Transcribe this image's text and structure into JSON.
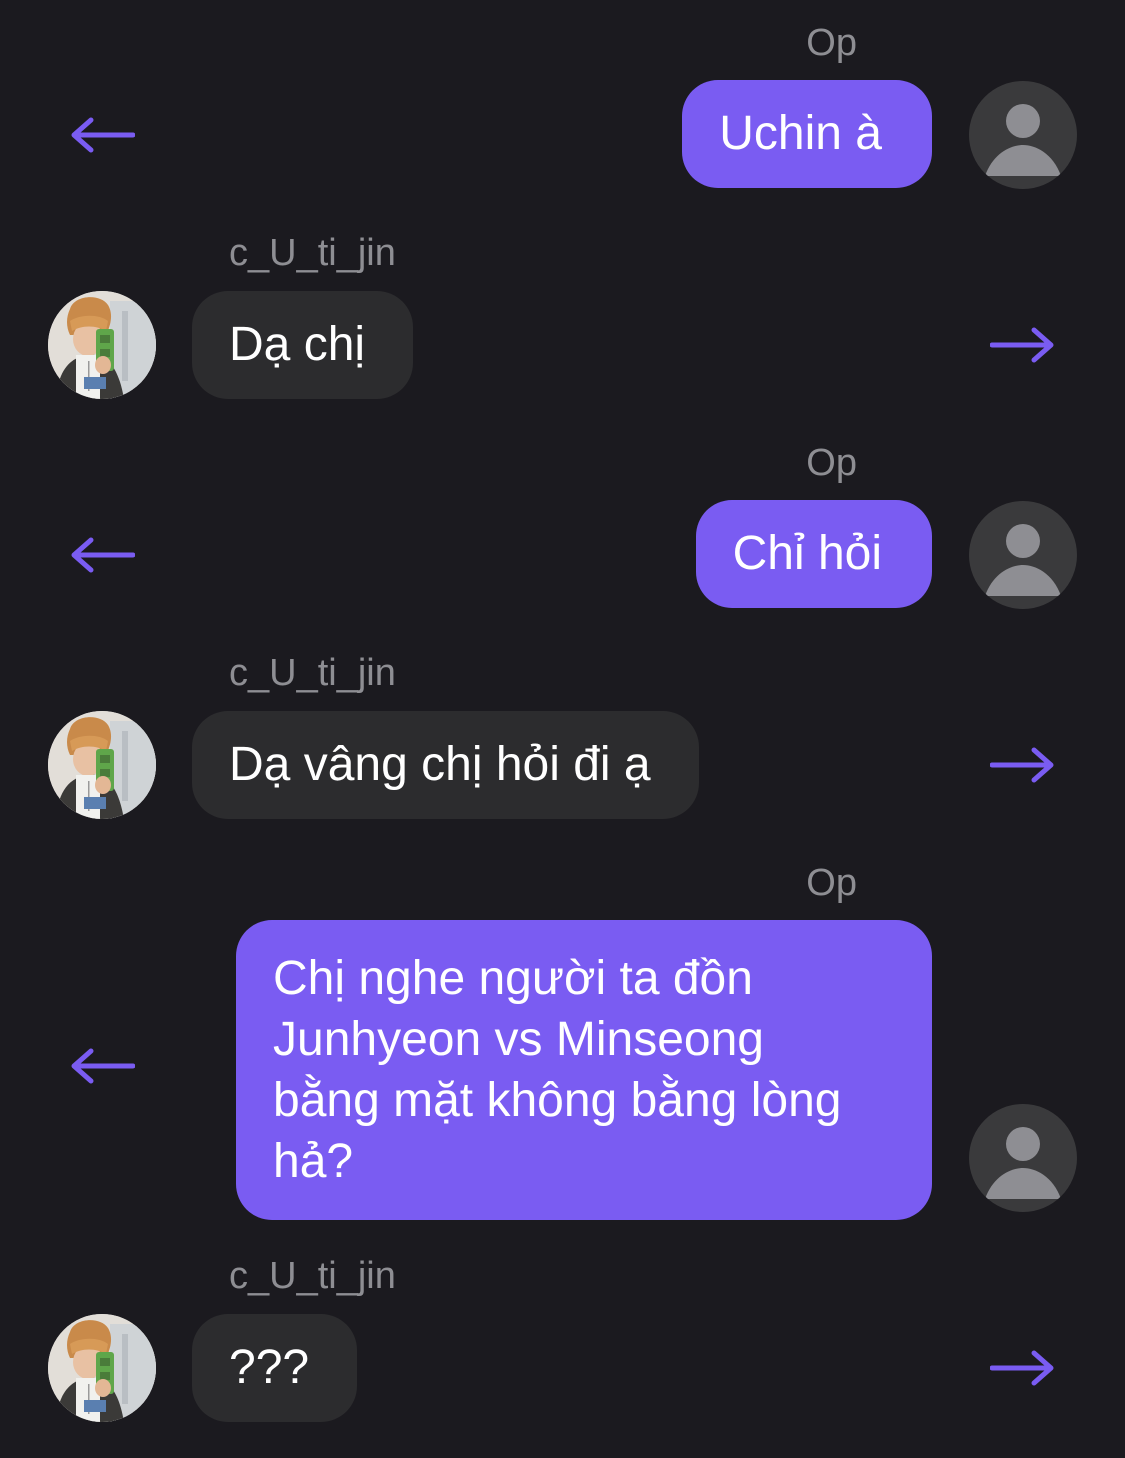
{
  "accent_color": "#7a5cf2",
  "messages": [
    {
      "sender": "Op",
      "side": "me",
      "text": "Uchin à",
      "action_icon": "arrow-left-icon",
      "avatar_icon": "default-avatar-icon"
    },
    {
      "sender": "c_U_ti_jin",
      "side": "them",
      "text": "Dạ chị",
      "action_icon": "arrow-right-icon",
      "avatar_icon": "profile-photo"
    },
    {
      "sender": "Op",
      "side": "me",
      "text": "Chỉ hỏi",
      "action_icon": "arrow-left-icon",
      "avatar_icon": "default-avatar-icon"
    },
    {
      "sender": "c_U_ti_jin",
      "side": "them",
      "text": "Dạ vâng chị hỏi đi ạ",
      "action_icon": "arrow-right-icon",
      "avatar_icon": "profile-photo"
    },
    {
      "sender": "Op",
      "side": "me",
      "lines": [
        "Chị nghe người ta đồn",
        "Junhyeon vs Minseong",
        "bằng mặt không bằng lòng",
        "hả?"
      ],
      "action_icon": "arrow-left-icon",
      "avatar_icon": "default-avatar-icon"
    },
    {
      "sender": "c_U_ti_jin",
      "side": "them",
      "text": "???",
      "action_icon": "arrow-right-icon",
      "avatar_icon": "profile-photo"
    }
  ]
}
